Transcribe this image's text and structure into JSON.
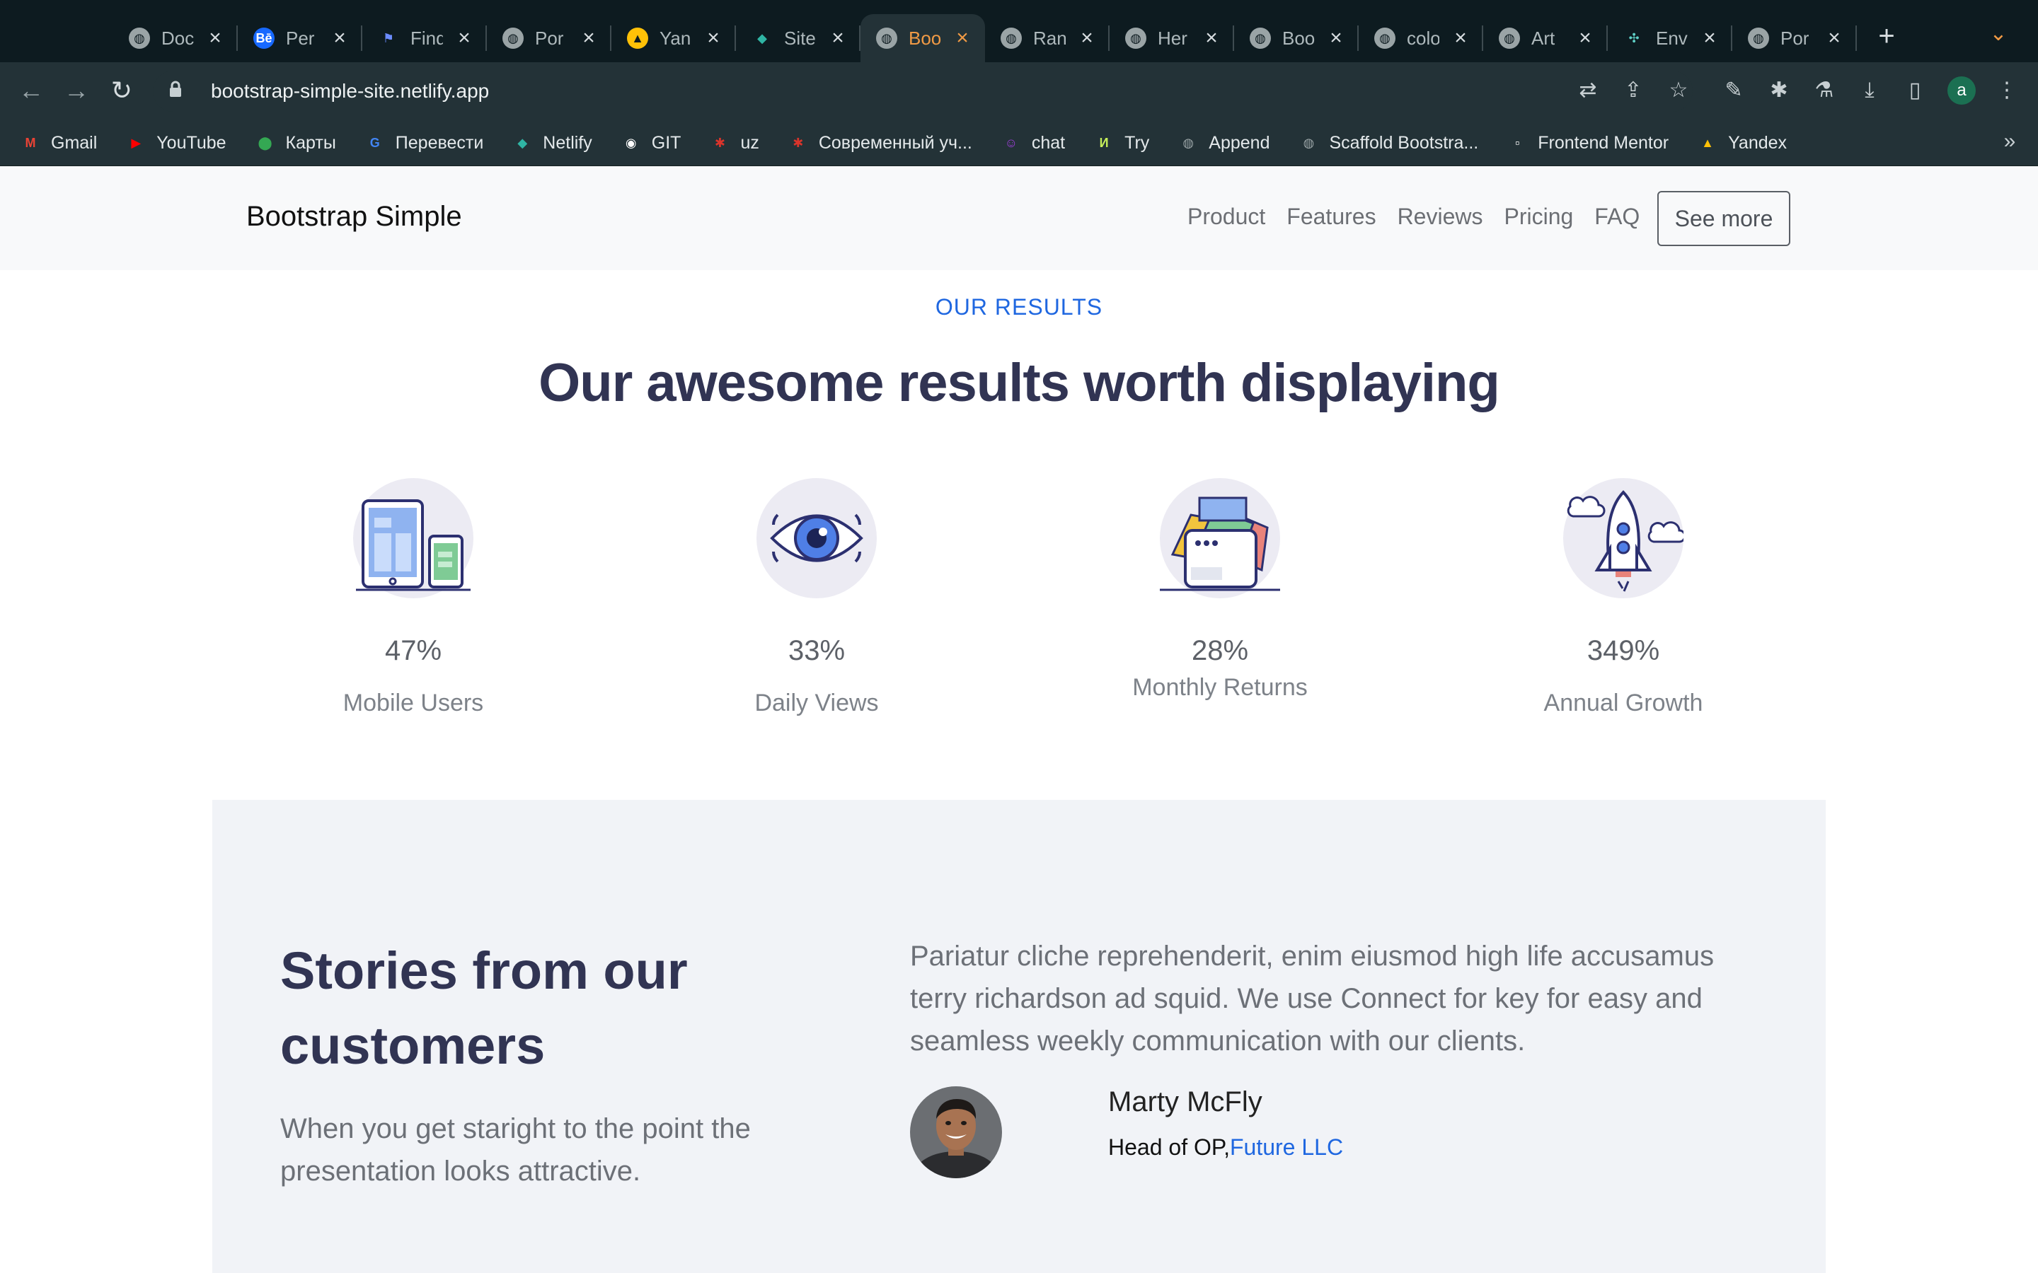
{
  "browser": {
    "tabs": [
      {
        "label": "Doc",
        "icon": "globe-icon",
        "active": false
      },
      {
        "label": "Per",
        "icon": "behance-icon",
        "active": false
      },
      {
        "label": "Find",
        "icon": "flag-icon",
        "active": false
      },
      {
        "label": "Por",
        "icon": "globe-icon",
        "active": false
      },
      {
        "label": "Yan",
        "icon": "yandex-images-icon",
        "active": false
      },
      {
        "label": "Site",
        "icon": "netlify-icon",
        "active": false
      },
      {
        "label": "Boo",
        "icon": "globe-icon",
        "active": true
      },
      {
        "label": "Ran",
        "icon": "globe-icon",
        "active": false
      },
      {
        "label": "Her",
        "icon": "globe-icon",
        "active": false
      },
      {
        "label": "Boo",
        "icon": "globe-icon",
        "active": false
      },
      {
        "label": "colo",
        "icon": "globe-icon",
        "active": false
      },
      {
        "label": "Art",
        "icon": "globe-icon",
        "active": false
      },
      {
        "label": "Env",
        "icon": "figma-icon",
        "active": false
      },
      {
        "label": "Por",
        "icon": "globe-icon",
        "active": false
      }
    ],
    "url": "bootstrap-simple-site.netlify.app",
    "profile_initial": "a",
    "bookmarks": [
      {
        "label": "Gmail",
        "icon": "gmail-icon",
        "color": "#ea4335"
      },
      {
        "label": "YouTube",
        "icon": "youtube-icon",
        "color": "#ff0000"
      },
      {
        "label": "Карты",
        "icon": "maps-pin-icon",
        "color": "#34a853"
      },
      {
        "label": "Перевести",
        "icon": "translate-icon",
        "color": "#4285f4"
      },
      {
        "label": "Netlify",
        "icon": "netlify-icon",
        "color": "#2fb5a4"
      },
      {
        "label": "GIT",
        "icon": "github-icon",
        "color": "#ffffff"
      },
      {
        "label": "uz",
        "icon": "figure-icon",
        "color": "#d9342b"
      },
      {
        "label": "Современный уч...",
        "icon": "figure-icon",
        "color": "#d9342b"
      },
      {
        "label": "chat",
        "icon": "chat-icon",
        "color": "#9c3fd6"
      },
      {
        "label": "Try",
        "icon": "try-icon",
        "color": "#c6ef5a"
      },
      {
        "label": "Append",
        "icon": "globe-icon",
        "color": "#9aa4a6"
      },
      {
        "label": "Scaffold Bootstra...",
        "icon": "globe-icon",
        "color": "#9aa4a6"
      },
      {
        "label": "Frontend Mentor",
        "icon": "frontend-mentor-icon",
        "color": "#ffffff"
      },
      {
        "label": "Yandex",
        "icon": "yandex-images-icon",
        "color": "#ffc107"
      }
    ]
  },
  "site": {
    "brand": "Bootstrap Simple",
    "nav": [
      "Product",
      "Features",
      "Reviews",
      "Pricing",
      "FAQ"
    ],
    "cta": "See more",
    "accent": "#1f67e0",
    "heading_color": "#313453"
  },
  "results": {
    "eyebrow": "OUR RESULTS",
    "title": "Our awesome results worth displaying",
    "stats": [
      {
        "value": "47%",
        "label": "Mobile Users",
        "icon": "devices-icon"
      },
      {
        "value": "33%",
        "label": "Daily Views",
        "icon": "eye-icon"
      },
      {
        "value": "28%",
        "label": "Monthly Returns",
        "icon": "wallet-icon"
      },
      {
        "value": "349%",
        "label": "Annual Growth",
        "icon": "rocket-icon"
      }
    ]
  },
  "stories": {
    "title": "Stories from our customers",
    "subtitle": "When you get staright to the point the presentation looks attractive.",
    "quote": "Pariatur cliche reprehenderit, enim eiusmod high life accusamus terry richardson ad squid. We use Connect for key for easy and seamless weekly communication with our clients.",
    "person": {
      "name": "Marty McFly",
      "role": "Head of OP,",
      "company": "Future LLC"
    }
  }
}
